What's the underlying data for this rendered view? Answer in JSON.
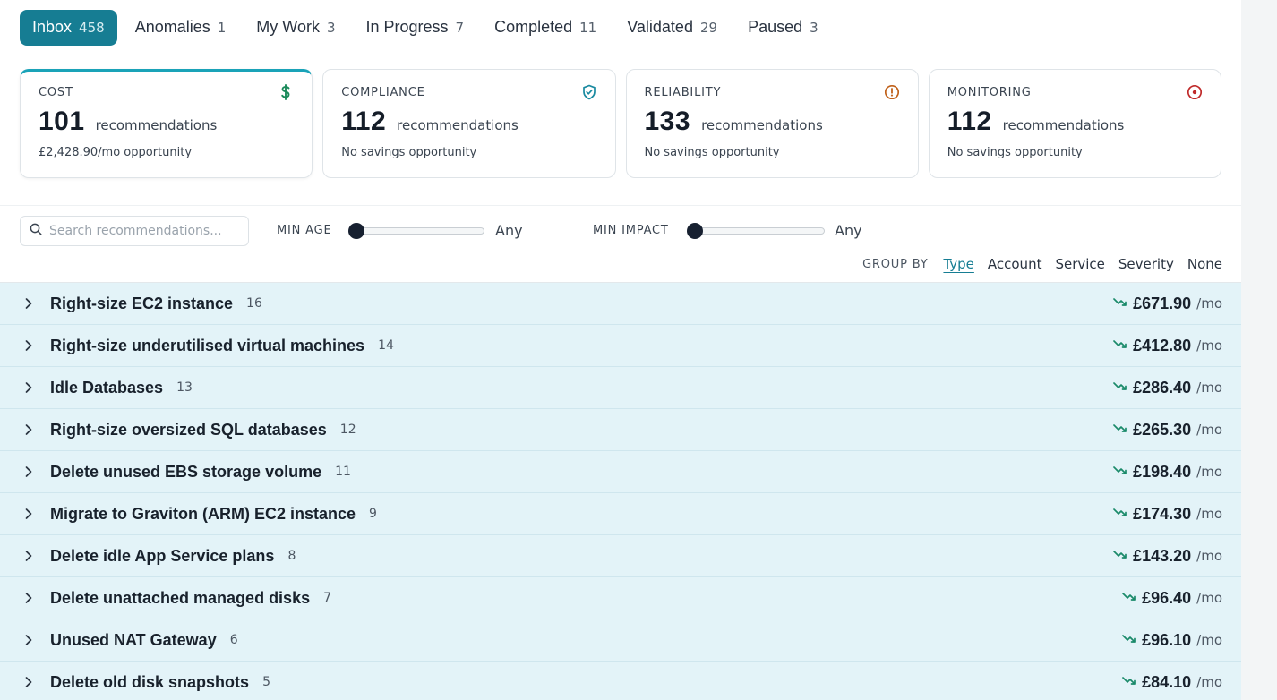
{
  "tabs": [
    {
      "label": "Inbox",
      "count": "458"
    },
    {
      "label": "Anomalies",
      "count": "1"
    },
    {
      "label": "My Work",
      "count": "3"
    },
    {
      "label": "In Progress",
      "count": "7"
    },
    {
      "label": "Completed",
      "count": "11"
    },
    {
      "label": "Validated",
      "count": "29"
    },
    {
      "label": "Paused",
      "count": "3"
    }
  ],
  "cards": [
    {
      "title": "COST",
      "count": "101",
      "unit": "recommendations",
      "sub": "£2,428.90/mo opportunity",
      "icon": "dollar-icon",
      "color": "#1a8a5a"
    },
    {
      "title": "COMPLIANCE",
      "count": "112",
      "unit": "recommendations",
      "sub": "No savings opportunity",
      "icon": "shield-check-icon",
      "color": "#1a8aa0"
    },
    {
      "title": "RELIABILITY",
      "count": "133",
      "unit": "recommendations",
      "sub": "No savings opportunity",
      "icon": "alert-circle-icon",
      "color": "#c0611a"
    },
    {
      "title": "MONITORING",
      "count": "112",
      "unit": "recommendations",
      "sub": "No savings opportunity",
      "icon": "target-icon",
      "color": "#c02a2a"
    }
  ],
  "filters": {
    "search_placeholder": "Search recommendations...",
    "min_age_label": "MIN AGE",
    "min_age_value": "Any",
    "min_impact_label": "MIN IMPACT",
    "min_impact_value": "Any"
  },
  "groupby": {
    "label": "GROUP BY",
    "options": [
      "Type",
      "Account",
      "Service",
      "Severity",
      "None"
    ],
    "selected": "Type"
  },
  "rows": [
    {
      "title": "Right-size EC2 instance",
      "count": "16",
      "amount": "£671.90",
      "per": "/mo"
    },
    {
      "title": "Right-size underutilised virtual machines",
      "count": "14",
      "amount": "£412.80",
      "per": "/mo"
    },
    {
      "title": "Idle Databases",
      "count": "13",
      "amount": "£286.40",
      "per": "/mo"
    },
    {
      "title": "Right-size oversized SQL databases",
      "count": "12",
      "amount": "£265.30",
      "per": "/mo"
    },
    {
      "title": "Delete unused EBS storage volume",
      "count": "11",
      "amount": "£198.40",
      "per": "/mo"
    },
    {
      "title": "Migrate to Graviton (ARM) EC2 instance",
      "count": "9",
      "amount": "£174.30",
      "per": "/mo"
    },
    {
      "title": "Delete idle App Service plans",
      "count": "8",
      "amount": "£143.20",
      "per": "/mo"
    },
    {
      "title": "Delete unattached managed disks",
      "count": "7",
      "amount": "£96.40",
      "per": "/mo"
    },
    {
      "title": "Unused NAT Gateway",
      "count": "6",
      "amount": "£96.10",
      "per": "/mo"
    },
    {
      "title": "Delete old disk snapshots",
      "count": "5",
      "amount": "£84.10",
      "per": "/mo"
    }
  ],
  "colors": {
    "accent": "#167d93",
    "row_bg": "#e3f3f8",
    "trend": "#1a8a6a"
  }
}
